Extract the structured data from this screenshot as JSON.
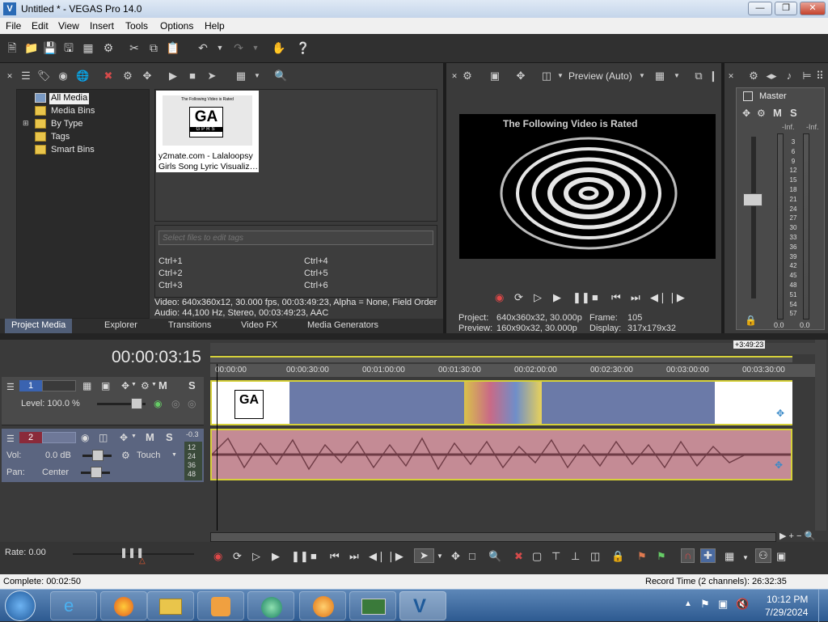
{
  "window": {
    "title": "Untitled * - VEGAS Pro 14.0"
  },
  "menu": [
    "File",
    "Edit",
    "View",
    "Insert",
    "Tools",
    "Options",
    "Help"
  ],
  "project_media": {
    "tree": [
      "All Media",
      "Media Bins",
      "By Type",
      "Tags",
      "Smart Bins"
    ],
    "thumb_line1": "The Following Video is Rated",
    "thumb_rating": "GA",
    "thumb_sub": "GPRS",
    "media_name_1": "y2mate.com - Lalaloopsy",
    "media_name_2": "Girls Song Lyric Visualiz…",
    "tag_placeholder": "Select files to edit tags",
    "shortcuts": [
      "Ctrl+1",
      "Ctrl+4",
      "Ctrl+2",
      "Ctrl+5",
      "Ctrl+3",
      "Ctrl+6"
    ],
    "video_info": "Video: 640x360x12, 30.000 fps, 00:03:49:23, Alpha = None, Field Order",
    "audio_info": "Audio: 44,100 Hz, Stereo, 00:03:49:23, AAC",
    "tabs": [
      "Project Media",
      "Explorer",
      "Transitions",
      "Video FX",
      "Media Generators"
    ]
  },
  "preview": {
    "quality": "Preview (Auto)",
    "screen_text": "The Following Video is Rated",
    "project_label": "Project:",
    "project_value": "640x360x32, 30.000p",
    "preview_label": "Preview:",
    "preview_value": "160x90x32, 30.000p",
    "frame_label": "Frame:",
    "frame_value": "105",
    "display_label": "Display:",
    "display_value": "317x179x32"
  },
  "master": {
    "label": "Master",
    "solo_mute": "M",
    "solo": "S",
    "inf_left": "-Inf.",
    "inf_right": "-Inf.",
    "scale": [
      "3",
      "6",
      "9",
      "12",
      "15",
      "18",
      "21",
      "24",
      "27",
      "30",
      "33",
      "36",
      "39",
      "42",
      "45",
      "48",
      "51",
      "54",
      "57"
    ],
    "bottom_left": "0.0",
    "bottom_right": "0.0"
  },
  "timeline": {
    "timecode": "00:00:03:15",
    "end_marker": "+3:49:23",
    "ruler": [
      "00:00:00",
      "00:00:30:00",
      "00:01:00:00",
      "00:01:30:00",
      "00:02:00:00",
      "00:02:30:00",
      "00:03:00:00",
      "00:03:30:00"
    ],
    "track1": {
      "number": "1",
      "level_label": "Level: 100.0 %",
      "m": "M",
      "s": "S"
    },
    "track2": {
      "number": "2",
      "vol_label": "Vol:",
      "vol_value": "0.0 dB",
      "pan_label": "Pan:",
      "pan_value": "Center",
      "mode": "Touch",
      "m": "M",
      "s": "S",
      "meter_top": "-0.3",
      "meter_marks": [
        "12",
        "24",
        "36",
        "48"
      ]
    },
    "rate": "Rate: 0.00"
  },
  "status": {
    "left": "Complete: 00:02:50",
    "right": "Record Time (2 channels): 26:32:35"
  },
  "taskbar": {
    "time": "10:12 PM",
    "date": "7/29/2024"
  },
  "colors": {
    "video_track": "#6b7aa8",
    "audio_track": "#c48b95",
    "track_border": "#d6d13a"
  }
}
